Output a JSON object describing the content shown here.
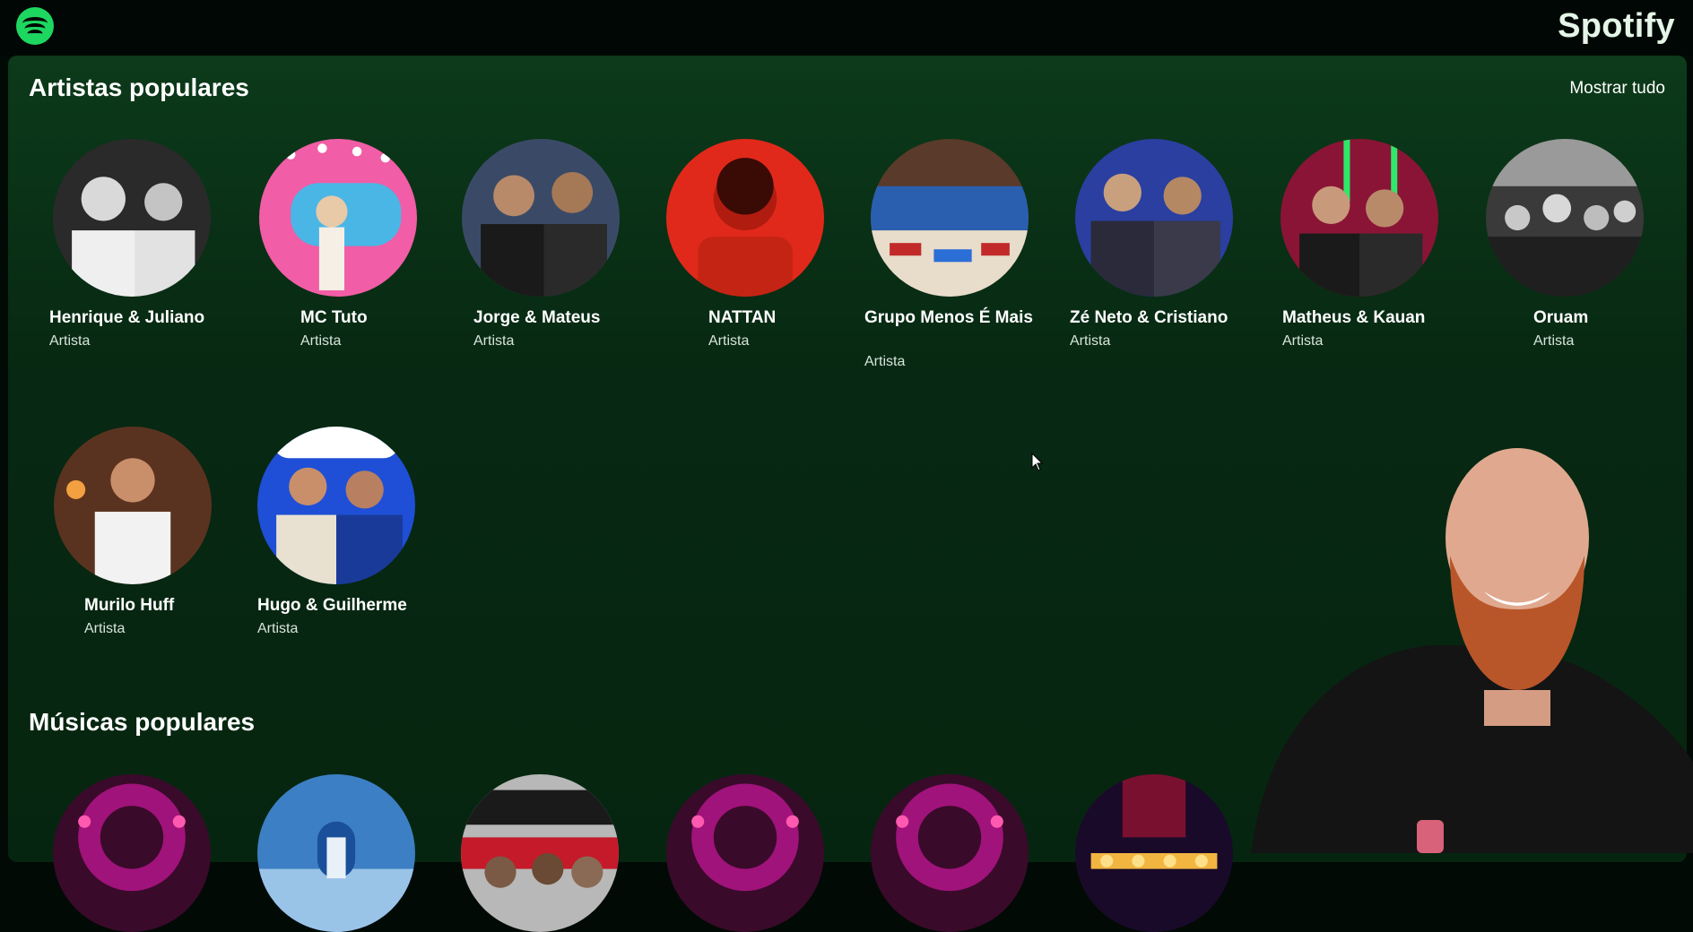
{
  "header": {
    "logo_icon": "spotify-logo-icon",
    "brand": "Spotify"
  },
  "artists_section": {
    "title": "Artistas populares",
    "show_all": "Mostrar tudo",
    "items": [
      {
        "name": "Henrique & Juliano",
        "type": "Artista",
        "tone": "#cfcfcf"
      },
      {
        "name": "MC Tuto",
        "type": "Artista",
        "tone": "#4ab6e6"
      },
      {
        "name": "Jorge & Mateus",
        "type": "Artista",
        "tone": "#3a4a66"
      },
      {
        "name": "NATTAN",
        "type": "Artista",
        "tone": "#e0291a"
      },
      {
        "name": "Grupo Menos É Mais",
        "type": "Artista",
        "tone": "#c8b8a6"
      },
      {
        "name": "Zé Neto & Cristiano",
        "type": "Artista",
        "tone": "#2a3fa0"
      },
      {
        "name": "Matheus & Kauan",
        "type": "Artista",
        "tone": "#8a1436"
      },
      {
        "name": "Oruam",
        "type": "Artista",
        "tone": "#8c8c8c"
      },
      {
        "name": "Murilo Huff",
        "type": "Artista",
        "tone": "#5a3320"
      },
      {
        "name": "Hugo & Guilherme",
        "type": "Artista",
        "tone": "#1f4fd6"
      }
    ]
  },
  "songs_section": {
    "title": "Músicas populares",
    "items": [
      {
        "tone": "#a0137a"
      },
      {
        "tone": "#3d7fc4"
      },
      {
        "tone": "#b8b8b8"
      },
      {
        "tone": "#a0137a"
      },
      {
        "tone": "#a0137a"
      },
      {
        "tone": "#4a0f2a"
      }
    ]
  },
  "colors": {
    "accent": "#1ed760",
    "background_top": "#0c3a1a",
    "background_bottom": "#062510"
  }
}
